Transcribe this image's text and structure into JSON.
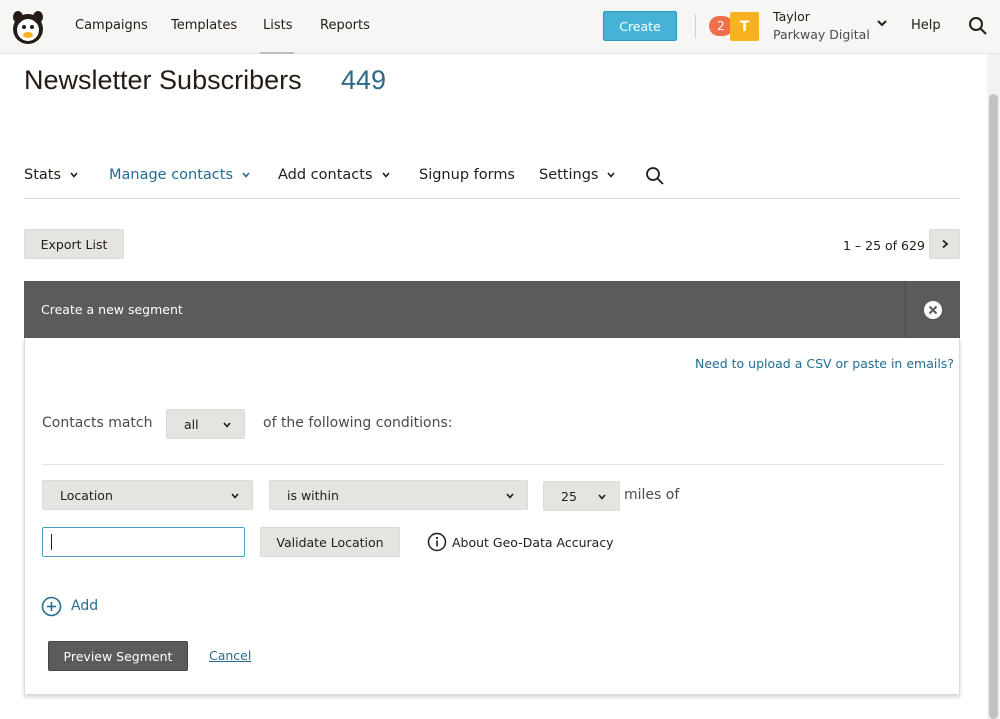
{
  "topnav": {
    "items": [
      "Campaigns",
      "Templates",
      "Lists",
      "Reports"
    ],
    "create_label": "Create",
    "notifications": "2",
    "avatar_initial": "T",
    "user_name": "Taylor",
    "user_org": "Parkway Digital",
    "help_label": "Help"
  },
  "page": {
    "title": "Newsletter Subscribers",
    "count": "449"
  },
  "subnav": {
    "stats": "Stats",
    "manage_contacts": "Manage contacts",
    "add_contacts": "Add contacts",
    "signup_forms": "Signup forms",
    "settings": "Settings"
  },
  "toolbar": {
    "export_label": "Export List",
    "pager": "1 – 25 of 629"
  },
  "segment": {
    "header_title": "Create a new segment",
    "csv_link": "Need to upload a CSV or paste in emails?",
    "match_prefix": "Contacts match",
    "match_value": "all",
    "match_suffix": "of the following conditions:",
    "field_value": "Location",
    "operator_value": "is within",
    "distance_value": "25",
    "unit_label": "miles of",
    "location_input_value": "",
    "validate_label": "Validate Location",
    "about_label": "About Geo-Data Accuracy",
    "add_label": "Add",
    "preview_label": "Preview Segment",
    "cancel_label": "Cancel"
  },
  "colors": {
    "accent_link": "#246d91",
    "create_button": "#46b3d6",
    "avatar": "#f9b21f",
    "badge": "#ee6f4a",
    "panel_header": "#5b5b5b"
  }
}
